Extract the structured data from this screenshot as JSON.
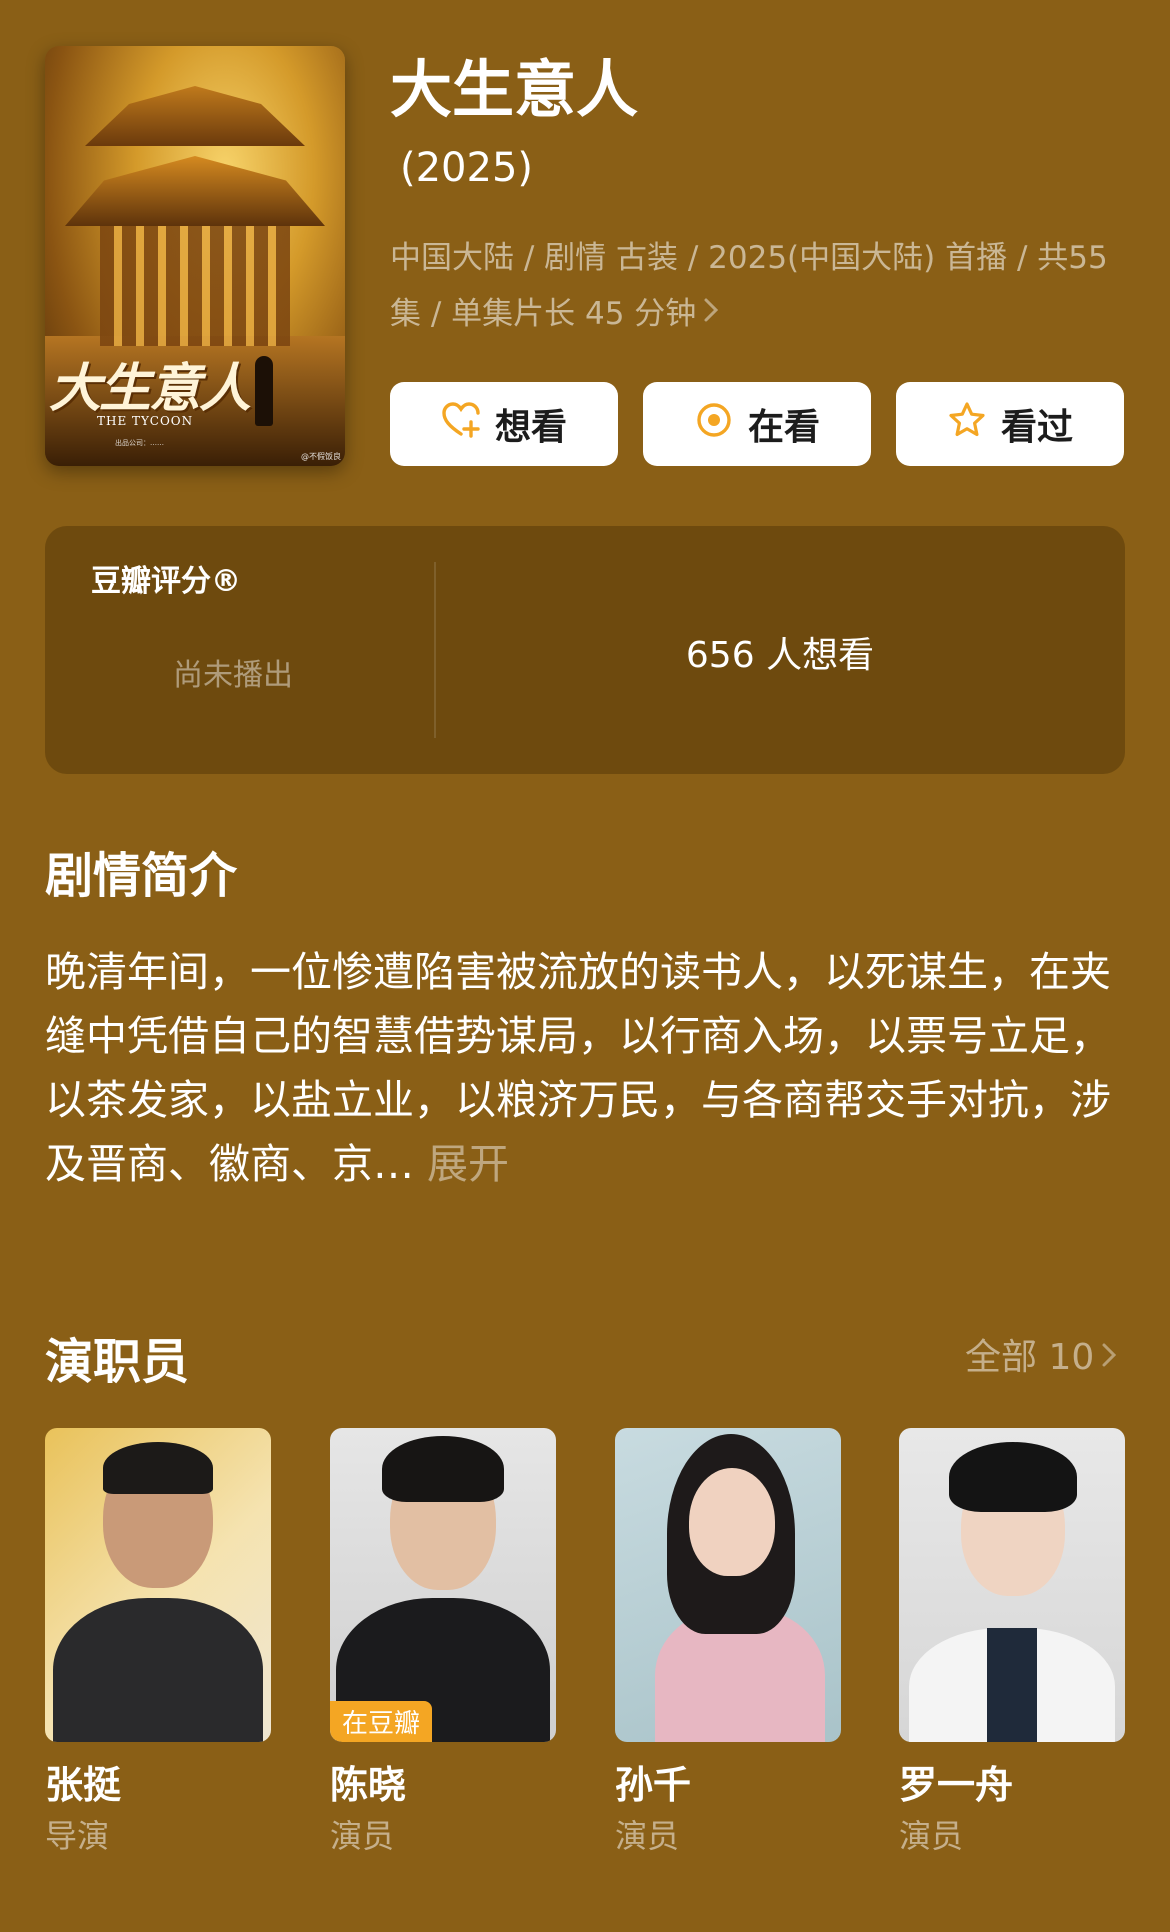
{
  "show": {
    "title": "大生意人",
    "year": " (2025)",
    "meta": "中国大陆 / 剧情 古装 / 2025(中国大陆) 首播 / 共55集 / 单集片长 45 分钟",
    "poster": {
      "calligraphy": "大生意人",
      "english": "THE TYCOON",
      "credit": "出品公司：……",
      "watermark": "@不假饭良"
    }
  },
  "actions": [
    {
      "label": "想看",
      "icon": "heart-plus-icon"
    },
    {
      "label": "在看",
      "icon": "target-icon"
    },
    {
      "label": "看过",
      "icon": "star-icon"
    }
  ],
  "rating": {
    "label": "豆瓣评分®",
    "status": "尚未播出",
    "want_count": "656 人想看"
  },
  "synopsis": {
    "heading": "剧情简介",
    "text": "晚清年间，一位惨遭陷害被流放的读书人，以死谋生，在夹缝中凭借自己的智慧借势谋局，以行商入场，以票号立足，以茶发家，以盐立业，以粮济万民，与各商帮交手对抗，涉及晋商、徽商、京…",
    "more": "展开"
  },
  "cast": {
    "heading": "演职员",
    "all_label": "全部 10",
    "members": [
      {
        "name": "张挺",
        "role": "导演"
      },
      {
        "name": "陈晓",
        "role": "演员",
        "tag": "在豆瓣"
      },
      {
        "name": "孙千",
        "role": "演员"
      },
      {
        "name": "罗一舟",
        "role": "演员"
      }
    ]
  },
  "colors": {
    "background": "#8a5f16",
    "card": "#6e4a0e",
    "accent": "#f4a623"
  }
}
